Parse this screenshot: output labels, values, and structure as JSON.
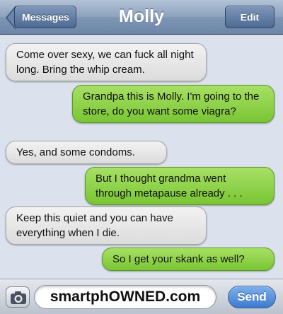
{
  "header": {
    "back_label": "Messages",
    "title": "Molly",
    "edit_label": "Edit"
  },
  "messages": [
    {
      "from": "contact",
      "text": "Come over sexy, we can fuck all night long. Bring the whip cream."
    },
    {
      "from": "me",
      "text": "Grandpa this is Molly. I'm going to the store, do you want some viagra?"
    },
    {
      "from": "contact",
      "text": "Yes, and some condoms."
    },
    {
      "from": "me",
      "text": "But I thought grandma went through metapause already . . ."
    },
    {
      "from": "contact",
      "text": "Keep this quiet and you can have everything when I die."
    },
    {
      "from": "me",
      "text": "So I get your skank as well?"
    }
  ],
  "composer": {
    "camera_icon": "camera-icon",
    "input_value": "smartphOWNED.com",
    "send_label": "Send"
  },
  "colors": {
    "incoming_bubble": "#e6e6e6",
    "outgoing_bubble": "#8fd24a",
    "navbar": "#8ea3be",
    "send_button": "#3c7ad0"
  }
}
